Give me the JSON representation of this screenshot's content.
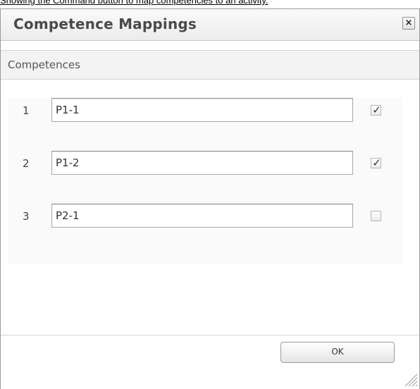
{
  "caption": "Showing the Command button to map competencies to an activity.",
  "dialog": {
    "title": "Competence Mappings",
    "close_glyph": "×",
    "section_label": "Competences",
    "rows": [
      {
        "number": "1",
        "value": "P1-1",
        "checked": true
      },
      {
        "number": "2",
        "value": "P1-2",
        "checked": true
      },
      {
        "number": "3",
        "value": "P2-1",
        "checked": false
      }
    ],
    "check_glyph": "✓",
    "ok_label": "OK"
  }
}
